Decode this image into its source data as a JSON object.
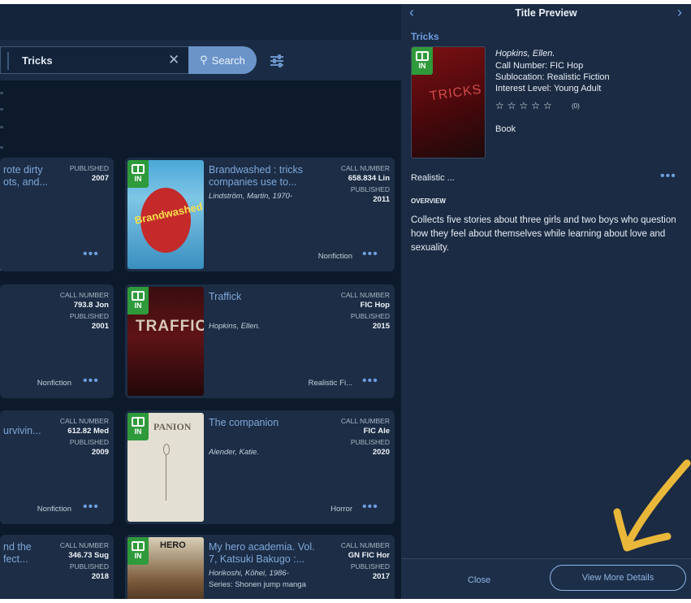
{
  "search": {
    "query": "Tricks",
    "clear_glyph": "✕",
    "button_label": "Search",
    "button_glyph": "⚲"
  },
  "cards": [
    {
      "title": "rote dirty\nots, and...",
      "meta_label_1": "PUBLISHED",
      "meta_value_1": "2007",
      "more": "•••"
    },
    {
      "title": "Brandwashed : tricks\ncompanies use to...",
      "author": "Lindström, Martin, 1970-",
      "meta_label_1": "CALL NUMBER",
      "meta_value_1": "658.834 Lin",
      "meta_label_2": "PUBLISHED",
      "meta_value_2": "2011",
      "genre": "Nonfiction",
      "more": "•••",
      "badge": "IN",
      "cover_text": "Brandwashed"
    },
    {
      "meta_label_1": "CALL NUMBER",
      "meta_value_1": "793.8 Jon",
      "meta_label_2": "PUBLISHED",
      "meta_value_2": "2001",
      "genre": "Nonfiction",
      "more": "•••"
    },
    {
      "title": "Traffick",
      "author": "Hopkins, Ellen.",
      "meta_label_1": "CALL NUMBER",
      "meta_value_1": "FIC Hop",
      "meta_label_2": "PUBLISHED",
      "meta_value_2": "2015",
      "genre": "Realistic Fi...",
      "more": "•••",
      "badge": "IN",
      "cover_text": "TRAFFICK"
    },
    {
      "title": "urvivin...",
      "meta_label_1": "CALL NUMBER",
      "meta_value_1": "612.82 Med",
      "meta_label_2": "PUBLISHED",
      "meta_value_2": "2009",
      "genre": "Nonfiction",
      "more": "•••"
    },
    {
      "title": "The companion",
      "author": "Alender, Katie.",
      "meta_label_1": "CALL NUMBER",
      "meta_value_1": "FIC Ale",
      "meta_label_2": "PUBLISHED",
      "meta_value_2": "2020",
      "genre": "Horror",
      "more": "•••",
      "badge": "IN",
      "cover_text": "PANION"
    },
    {
      "title": "nd the\nfect...",
      "meta_label_1": "CALL NUMBER",
      "meta_value_1": "346.73 Sug",
      "meta_label_2": "PUBLISHED",
      "meta_value_2": "2018"
    },
    {
      "title": "My hero academia. Vol.\n7, Katsuki Bakugo :...",
      "author": "Horikoshi, Kōhei, 1986-",
      "series": "Series: Shonen jump manga",
      "meta_label_1": "CALL NUMBER",
      "meta_value_1": "GN FIC Hor",
      "meta_label_2": "PUBLISHED",
      "meta_value_2": "2017",
      "badge": "IN",
      "cover_text": "HERO"
    }
  ],
  "preview": {
    "heading": "Title Preview",
    "prev_glyph": "‹",
    "next_glyph": "›",
    "title": "Tricks",
    "badge": "IN",
    "cover_text": "TRICKS",
    "author": "Hopkins, Ellen.",
    "call_number": "Call Number: FIC Hop",
    "sublocation": "Sublocation: Realistic Fiction",
    "interest_level": "Interest Level: Young Adult",
    "stars": "☆☆☆☆☆",
    "stars_count": "(0)",
    "format": "Book",
    "genre": "Realistic ...",
    "more": "•••",
    "overview_heading": "OVERVIEW",
    "overview": "Collects five stories about three girls and two boys who question how they feel about themselves while learning about love and sexuality.",
    "close_label": "Close",
    "details_label": "View More Details"
  },
  "colors": {
    "accent": "#6e9ee0",
    "panel": "#1b2b43",
    "card": "#1c2d45",
    "badge_green": "#2f9a3b",
    "annotation_arrow": "#e9b83a"
  },
  "icons": [
    "search-icon",
    "clear-icon",
    "filter-icon",
    "book-icon",
    "chevron-left-icon",
    "chevron-right-icon",
    "star-icon",
    "more-icon",
    "arrow-annotation-icon"
  ]
}
